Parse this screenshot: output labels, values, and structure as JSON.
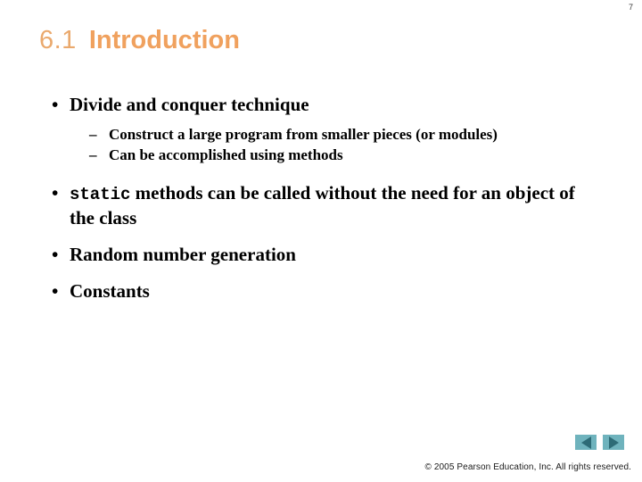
{
  "slide": {
    "page_number": "7",
    "title": {
      "number": "6.1",
      "text": "Introduction"
    },
    "bullets": [
      {
        "level": 1,
        "marker": "•",
        "text": "Divide and conquer technique"
      },
      {
        "level": 2,
        "marker": "–",
        "text": "Construct a large program from smaller pieces (or modules)"
      },
      {
        "level": 2,
        "marker": "–",
        "text": "Can be accomplished using methods"
      },
      {
        "level": 1,
        "marker": "•",
        "code": "static",
        "text": " methods can be called without the need for an object of the class"
      },
      {
        "level": 1,
        "marker": "•",
        "text": "Random number generation"
      },
      {
        "level": 1,
        "marker": "•",
        "text": "Constants"
      }
    ],
    "footer": {
      "copyright": "© 2005 Pearson Education, Inc.  All rights reserved.",
      "nav": {
        "previous_label": "◀",
        "next_label": "▶"
      }
    },
    "colors": {
      "background": "#ffffff",
      "title_number": "#eaa96d",
      "title_text": "#f0a15e",
      "body_text": "#000000",
      "nav_button_bg": "#6fb3bd",
      "nav_arrow": "#2d6b76"
    }
  }
}
